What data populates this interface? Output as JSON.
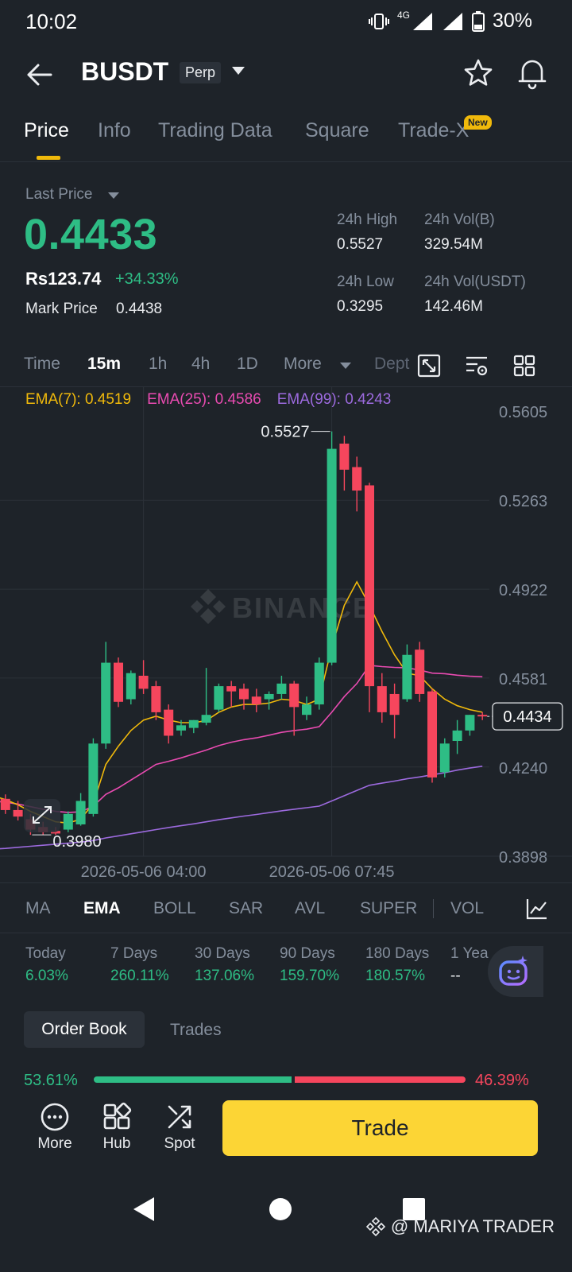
{
  "status_bar": {
    "time": "10:02",
    "network": "4G",
    "battery": "30%"
  },
  "header": {
    "symbol": "BUSDT",
    "badge": "Perp"
  },
  "tabs": [
    {
      "label": "Price",
      "active": true
    },
    {
      "label": "Info"
    },
    {
      "label": "Trading Data"
    },
    {
      "label": "Square"
    },
    {
      "label": "Trade-X"
    }
  ],
  "new_badge": "New",
  "price_panel": {
    "last_price_label": "Last Price",
    "last_price": "0.4433",
    "rs_price": "Rs123.74",
    "change": "+34.33%",
    "mark_price_label": "Mark Price",
    "mark_price": "0.4438",
    "stats": {
      "high_label": "24h High",
      "high": "0.5527",
      "vol_b_label": "24h Vol(B)",
      "vol_b": "329.54M",
      "low_label": "24h Low",
      "low": "0.3295",
      "vol_usdt_label": "24h Vol(USDT)",
      "vol_usdt": "142.46M"
    }
  },
  "intervals": [
    {
      "label": "Time"
    },
    {
      "label": "15m",
      "active": true
    },
    {
      "label": "1h"
    },
    {
      "label": "4h"
    },
    {
      "label": "1D"
    },
    {
      "label": "More"
    },
    {
      "label": "Dept"
    }
  ],
  "ema_legend": [
    {
      "label": "EMA(7): 0.4519",
      "color": "#f0b90b"
    },
    {
      "label": "EMA(25): 0.4586",
      "color": "#e94bb1"
    },
    {
      "label": "EMA(99): 0.4243",
      "color": "#9c6ade"
    }
  ],
  "chart_data": {
    "type": "candlestick",
    "watermark": "BINANCE",
    "y_ticks": [
      "0.5605",
      "0.5263",
      "0.4922",
      "0.4581",
      "0.4240",
      "0.3898"
    ],
    "x_ticks": [
      "2026-05-06 04:00",
      "2026-05-06 07:45"
    ],
    "ylim": [
      0.3898,
      0.5605
    ],
    "high_marker": "0.5527",
    "low_marker": "0.3980",
    "current_price_label": "0.4434",
    "current_price": 0.4434,
    "candles": [
      {
        "o": 0.4145,
        "h": 0.416,
        "c": 0.412,
        "l": 0.4105
      },
      {
        "o": 0.4118,
        "h": 0.4135,
        "c": 0.4075,
        "l": 0.406
      },
      {
        "o": 0.4075,
        "h": 0.411,
        "c": 0.405,
        "l": 0.4035
      },
      {
        "o": 0.404,
        "h": 0.406,
        "c": 0.4,
        "l": 0.398
      },
      {
        "o": 0.401,
        "h": 0.403,
        "c": 0.399,
        "l": 0.398
      },
      {
        "o": 0.3995,
        "h": 0.401,
        "c": 0.3985,
        "l": 0.398
      },
      {
        "o": 0.4,
        "h": 0.407,
        "c": 0.406,
        "l": 0.399
      },
      {
        "o": 0.402,
        "h": 0.414,
        "c": 0.411,
        "l": 0.4015
      },
      {
        "o": 0.406,
        "h": 0.435,
        "c": 0.433,
        "l": 0.405
      },
      {
        "o": 0.433,
        "h": 0.472,
        "c": 0.464,
        "l": 0.431
      },
      {
        "o": 0.464,
        "h": 0.466,
        "c": 0.449,
        "l": 0.447
      },
      {
        "o": 0.45,
        "h": 0.461,
        "c": 0.46,
        "l": 0.448
      },
      {
        "o": 0.459,
        "h": 0.465,
        "c": 0.454,
        "l": 0.452
      },
      {
        "o": 0.455,
        "h": 0.457,
        "c": 0.445,
        "l": 0.442
      },
      {
        "o": 0.446,
        "h": 0.448,
        "c": 0.436,
        "l": 0.433
      },
      {
        "o": 0.438,
        "h": 0.442,
        "c": 0.44,
        "l": 0.436
      },
      {
        "o": 0.439,
        "h": 0.442,
        "c": 0.442,
        "l": 0.437
      },
      {
        "o": 0.441,
        "h": 0.462,
        "c": 0.444,
        "l": 0.44
      },
      {
        "o": 0.446,
        "h": 0.456,
        "c": 0.455,
        "l": 0.445
      },
      {
        "o": 0.455,
        "h": 0.457,
        "c": 0.453,
        "l": 0.447
      },
      {
        "o": 0.454,
        "h": 0.456,
        "c": 0.45,
        "l": 0.446
      },
      {
        "o": 0.451,
        "h": 0.454,
        "c": 0.448,
        "l": 0.445
      },
      {
        "o": 0.45,
        "h": 0.453,
        "c": 0.452,
        "l": 0.446
      },
      {
        "o": 0.452,
        "h": 0.459,
        "c": 0.456,
        "l": 0.45
      },
      {
        "o": 0.456,
        "h": 0.457,
        "c": 0.447,
        "l": 0.436
      },
      {
        "o": 0.444,
        "h": 0.451,
        "c": 0.448,
        "l": 0.442
      },
      {
        "o": 0.448,
        "h": 0.466,
        "c": 0.464,
        "l": 0.446
      },
      {
        "o": 0.464,
        "h": 0.5527,
        "c": 0.546,
        "l": 0.463
      },
      {
        "o": 0.548,
        "h": 0.551,
        "c": 0.538,
        "l": 0.53
      },
      {
        "o": 0.539,
        "h": 0.543,
        "c": 0.53,
        "l": 0.522
      },
      {
        "o": 0.532,
        "h": 0.533,
        "c": 0.455,
        "l": 0.445
      },
      {
        "o": 0.455,
        "h": 0.46,
        "c": 0.445,
        "l": 0.441
      },
      {
        "o": 0.452,
        "h": 0.456,
        "c": 0.444,
        "l": 0.435
      },
      {
        "o": 0.45,
        "h": 0.471,
        "c": 0.467,
        "l": 0.449
      },
      {
        "o": 0.469,
        "h": 0.472,
        "c": 0.452,
        "l": 0.449
      },
      {
        "o": 0.453,
        "h": 0.454,
        "c": 0.42,
        "l": 0.418
      },
      {
        "o": 0.422,
        "h": 0.435,
        "c": 0.433,
        "l": 0.42
      },
      {
        "o": 0.434,
        "h": 0.442,
        "c": 0.438,
        "l": 0.429
      },
      {
        "o": 0.438,
        "h": 0.444,
        "c": 0.444,
        "l": 0.436
      },
      {
        "o": 0.444,
        "h": 0.445,
        "c": 0.4434,
        "l": 0.442
      }
    ],
    "ema7": [
      0.413,
      0.4115,
      0.4095,
      0.407,
      0.405,
      0.403,
      0.4025,
      0.404,
      0.41,
      0.425,
      0.432,
      0.438,
      0.442,
      0.4435,
      0.442,
      0.441,
      0.441,
      0.4418,
      0.445,
      0.447,
      0.448,
      0.448,
      0.4485,
      0.45,
      0.4495,
      0.448,
      0.45,
      0.47,
      0.486,
      0.495,
      0.486,
      0.476,
      0.467,
      0.46,
      0.459,
      0.454,
      0.45,
      0.4475,
      0.446,
      0.445
    ],
    "ema25": [
      0.411,
      0.4105,
      0.4098,
      0.4088,
      0.4078,
      0.407,
      0.4066,
      0.4068,
      0.409,
      0.4135,
      0.416,
      0.419,
      0.422,
      0.425,
      0.4262,
      0.4275,
      0.429,
      0.4305,
      0.4322,
      0.4335,
      0.4345,
      0.4352,
      0.4362,
      0.4373,
      0.438,
      0.4385,
      0.4395,
      0.445,
      0.451,
      0.456,
      0.463,
      0.4625,
      0.4622,
      0.462,
      0.4612,
      0.46,
      0.4598,
      0.4592,
      0.4588,
      0.4586
    ],
    "ema99": [
      0.3925,
      0.3928,
      0.3932,
      0.3936,
      0.394,
      0.3944,
      0.3948,
      0.3952,
      0.3958,
      0.3968,
      0.3976,
      0.3984,
      0.3992,
      0.4,
      0.4008,
      0.4015,
      0.4022,
      0.403,
      0.4038,
      0.4045,
      0.4052,
      0.4058,
      0.4065,
      0.4072,
      0.4078,
      0.4084,
      0.409,
      0.411,
      0.413,
      0.415,
      0.417,
      0.4178,
      0.4186,
      0.4195,
      0.4202,
      0.421,
      0.4218,
      0.4228,
      0.4236,
      0.4243
    ]
  },
  "indicators": [
    {
      "label": "MA"
    },
    {
      "label": "EMA",
      "active": true
    },
    {
      "label": "BOLL"
    },
    {
      "label": "SAR"
    },
    {
      "label": "AVL"
    },
    {
      "label": "SUPER"
    },
    {
      "label": "VOL"
    }
  ],
  "performance": [
    {
      "label": "Today",
      "value": "6.03%"
    },
    {
      "label": "7 Days",
      "value": "260.11%"
    },
    {
      "label": "30 Days",
      "value": "137.06%"
    },
    {
      "label": "90 Days",
      "value": "159.70%"
    },
    {
      "label": "180 Days",
      "value": "180.57%"
    },
    {
      "label": "1 Yea",
      "value": "--"
    }
  ],
  "orderbook": {
    "tab_orderbook": "Order Book",
    "tab_trades": "Trades",
    "buy_pct": "53.61%",
    "sell_pct": "46.39%",
    "buy_ratio": 0.5361
  },
  "actions": {
    "more": "More",
    "hub": "Hub",
    "spot": "Spot",
    "trade": "Trade"
  },
  "watermark": "@ MARIYA TRADER",
  "colors": {
    "up": "#2ebd85",
    "down": "#f6465d",
    "accent": "#fcd535",
    "bg": "#1e2329"
  }
}
